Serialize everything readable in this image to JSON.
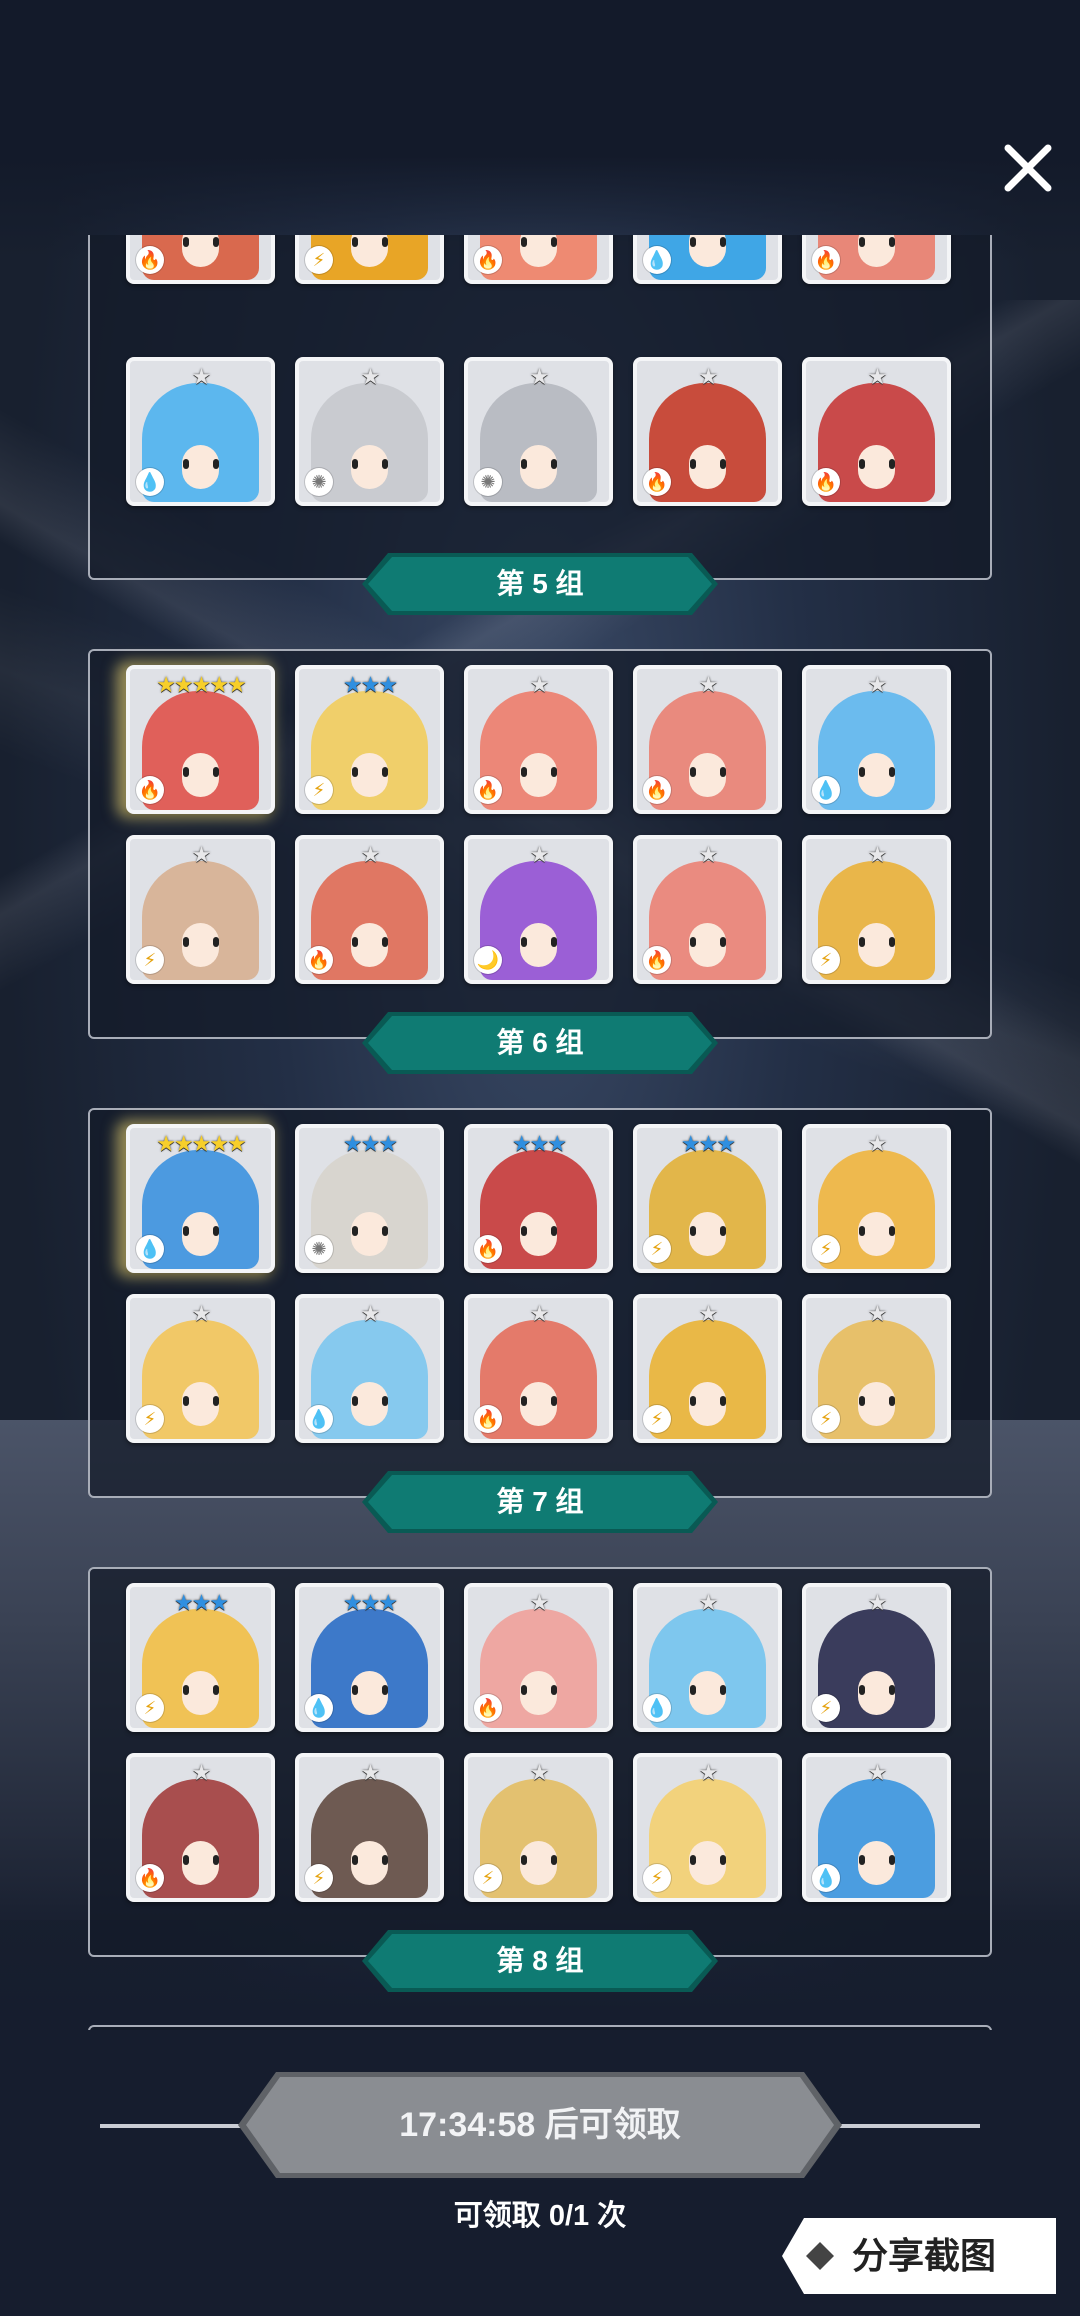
{
  "header": {
    "close_icon": "close-icon"
  },
  "groups": [
    {
      "label": "",
      "rows": [
        [
          {
            "stars": "",
            "elem": "fire",
            "color": "#d9694e"
          },
          {
            "stars": "",
            "elem": "light",
            "color": "#e8a526"
          },
          {
            "stars": "",
            "elem": "fire",
            "color": "#ee8a72"
          },
          {
            "stars": "",
            "elem": "water",
            "color": "#3fa6e6"
          },
          {
            "stars": "",
            "elem": "fire",
            "color": "#e88778"
          }
        ],
        [
          {
            "stars": "★",
            "elem": "water",
            "color": "#5cb7ee"
          },
          {
            "stars": "★",
            "elem": "sun",
            "color": "#c9cbd0"
          },
          {
            "stars": "★",
            "elem": "sun",
            "color": "#b9bcc3"
          },
          {
            "stars": "★",
            "elem": "fire",
            "color": "#c84c3c"
          },
          {
            "stars": "★",
            "elem": "fire",
            "color": "#c94a4a"
          }
        ]
      ]
    },
    {
      "label": "第 5 组"
    },
    {
      "label": "第 6 组",
      "rows": [
        [
          {
            "stars": "★★★★★",
            "elem": "fire",
            "color": "#e0605a",
            "glow": true
          },
          {
            "stars": "★★★",
            "elem": "light",
            "color": "#f0cf6a"
          },
          {
            "stars": "★",
            "elem": "fire",
            "color": "#ec8778"
          },
          {
            "stars": "★",
            "elem": "fire",
            "color": "#e98a7e"
          },
          {
            "stars": "★",
            "elem": "water",
            "color": "#6bbbee"
          }
        ],
        [
          {
            "stars": "★",
            "elem": "light",
            "color": "#d8b59a"
          },
          {
            "stars": "★",
            "elem": "fire",
            "color": "#e07763"
          },
          {
            "stars": "★",
            "elem": "dark",
            "color": "#9b5fd6"
          },
          {
            "stars": "★",
            "elem": "fire",
            "color": "#ea8b80"
          },
          {
            "stars": "★",
            "elem": "light",
            "color": "#e9b64a"
          }
        ]
      ]
    },
    {
      "label": "第 7 组",
      "rows": [
        [
          {
            "stars": "★★★★★",
            "elem": "water",
            "color": "#4c9ae0",
            "glow": true
          },
          {
            "stars": "★★★",
            "elem": "sun",
            "color": "#d8d5cf"
          },
          {
            "stars": "★★★",
            "elem": "fire",
            "color": "#c94a4a"
          },
          {
            "stars": "★★★",
            "elem": "light",
            "color": "#e2b64a"
          },
          {
            "stars": "★",
            "elem": "light",
            "color": "#eeb94e"
          }
        ],
        [
          {
            "stars": "★",
            "elem": "light",
            "color": "#f1c867"
          },
          {
            "stars": "★",
            "elem": "water",
            "color": "#86c9ee"
          },
          {
            "stars": "★",
            "elem": "fire",
            "color": "#e47a6a"
          },
          {
            "stars": "★",
            "elem": "light",
            "color": "#e9b847"
          },
          {
            "stars": "★",
            "elem": "light",
            "color": "#e7c06a"
          }
        ]
      ]
    },
    {
      "label": "第 8 组",
      "rows": [
        [
          {
            "stars": "★★★",
            "elem": "light",
            "color": "#f0c255"
          },
          {
            "stars": "★★★",
            "elem": "water",
            "color": "#3d79c9"
          },
          {
            "stars": "★",
            "elem": "fire",
            "color": "#eea7a2"
          },
          {
            "stars": "★",
            "elem": "water",
            "color": "#7ec7ee"
          },
          {
            "stars": "★",
            "elem": "light",
            "color": "#3a3c5c"
          }
        ],
        [
          {
            "stars": "★",
            "elem": "fire",
            "color": "#a84e4e"
          },
          {
            "stars": "★",
            "elem": "light",
            "color": "#6e5a52"
          },
          {
            "stars": "★",
            "elem": "light",
            "color": "#e3c170"
          },
          {
            "stars": "★",
            "elem": "light",
            "color": "#f2d27c"
          },
          {
            "stars": "★",
            "elem": "water",
            "color": "#4b9de0"
          }
        ]
      ]
    }
  ],
  "claim": {
    "timer_label": "17:34:58 后可领取",
    "count_label": "可领取 0/1 次"
  },
  "share": {
    "label": "分享截图",
    "icon": "diamond-icon"
  },
  "colors": {
    "ribbon": "#0f7b73",
    "ribbon_dark": "#095a54",
    "claim_bg": "#8a8d92",
    "star_gold": "#f7cf2a",
    "star_blue": "#2f8fe0",
    "star_silver": "#e8e8ea"
  }
}
